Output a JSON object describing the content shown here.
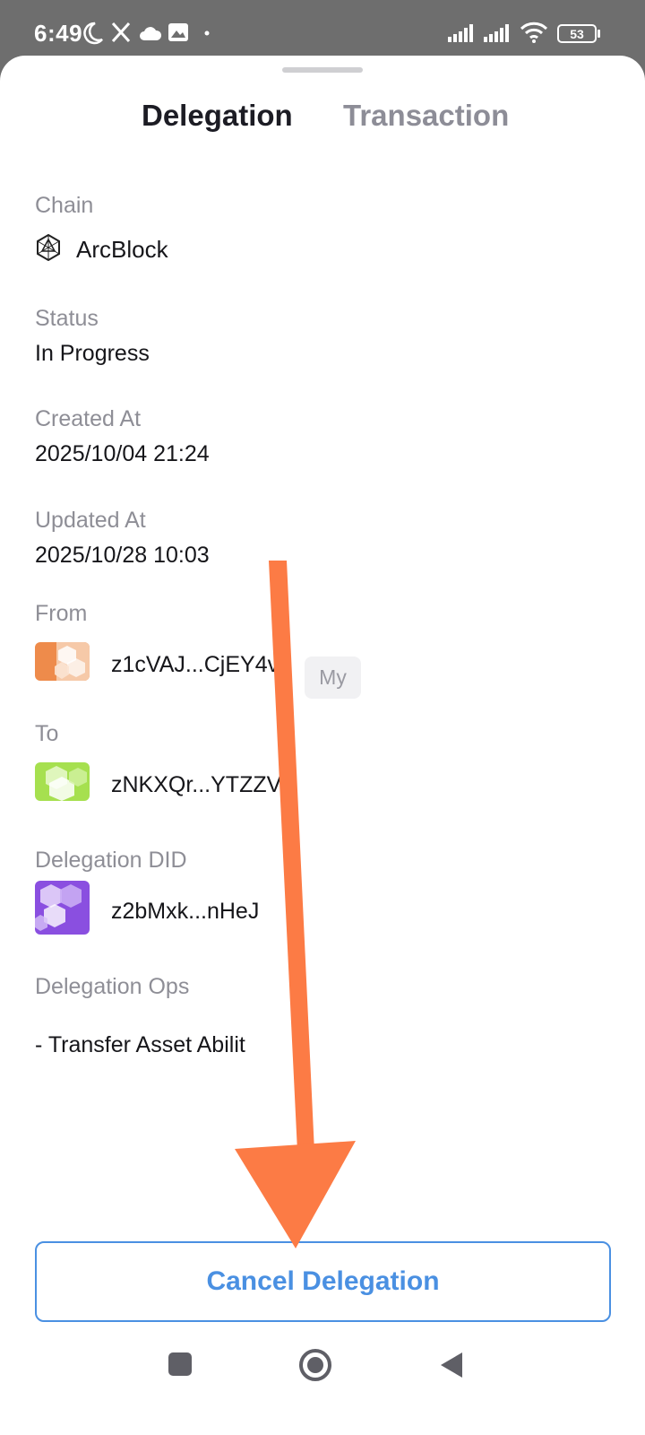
{
  "status_bar": {
    "time": "6:49",
    "battery": "53",
    "icons": [
      "moon-icon",
      "x-icon",
      "cloud-icon",
      "gallery-icon",
      "dot-icon",
      "signal-icon",
      "signal-icon",
      "wifi-icon",
      "battery-icon"
    ]
  },
  "tabs": {
    "active": "Delegation",
    "inactive": "Transaction"
  },
  "fields": {
    "chain_label": "Chain",
    "chain_value": "ArcBlock",
    "status_label": "Status",
    "status_value": "In Progress",
    "created_label": "Created At",
    "created_value": "2025/10/04 21:24",
    "updated_label": "Updated At",
    "updated_value": "2025/10/28 10:03",
    "from_label": "From",
    "from_value": "z1cVAJ...CjEY4v",
    "from_badge": "My",
    "to_label": "To",
    "to_value": "zNKXQr...YTZZV",
    "did_label": "Delegation DID",
    "did_value": "z2bMxk...nHeJ",
    "ops_label": "Delegation Ops",
    "ops_value": "- Transfer Asset Abilit"
  },
  "actions": {
    "cancel_label": "Cancel Delegation"
  },
  "colors": {
    "accent": "#4a90e2",
    "annotation_arrow": "#fc7b45"
  },
  "nav": {
    "icons": [
      "square-recents-icon",
      "circle-home-icon",
      "triangle-back-icon"
    ]
  }
}
